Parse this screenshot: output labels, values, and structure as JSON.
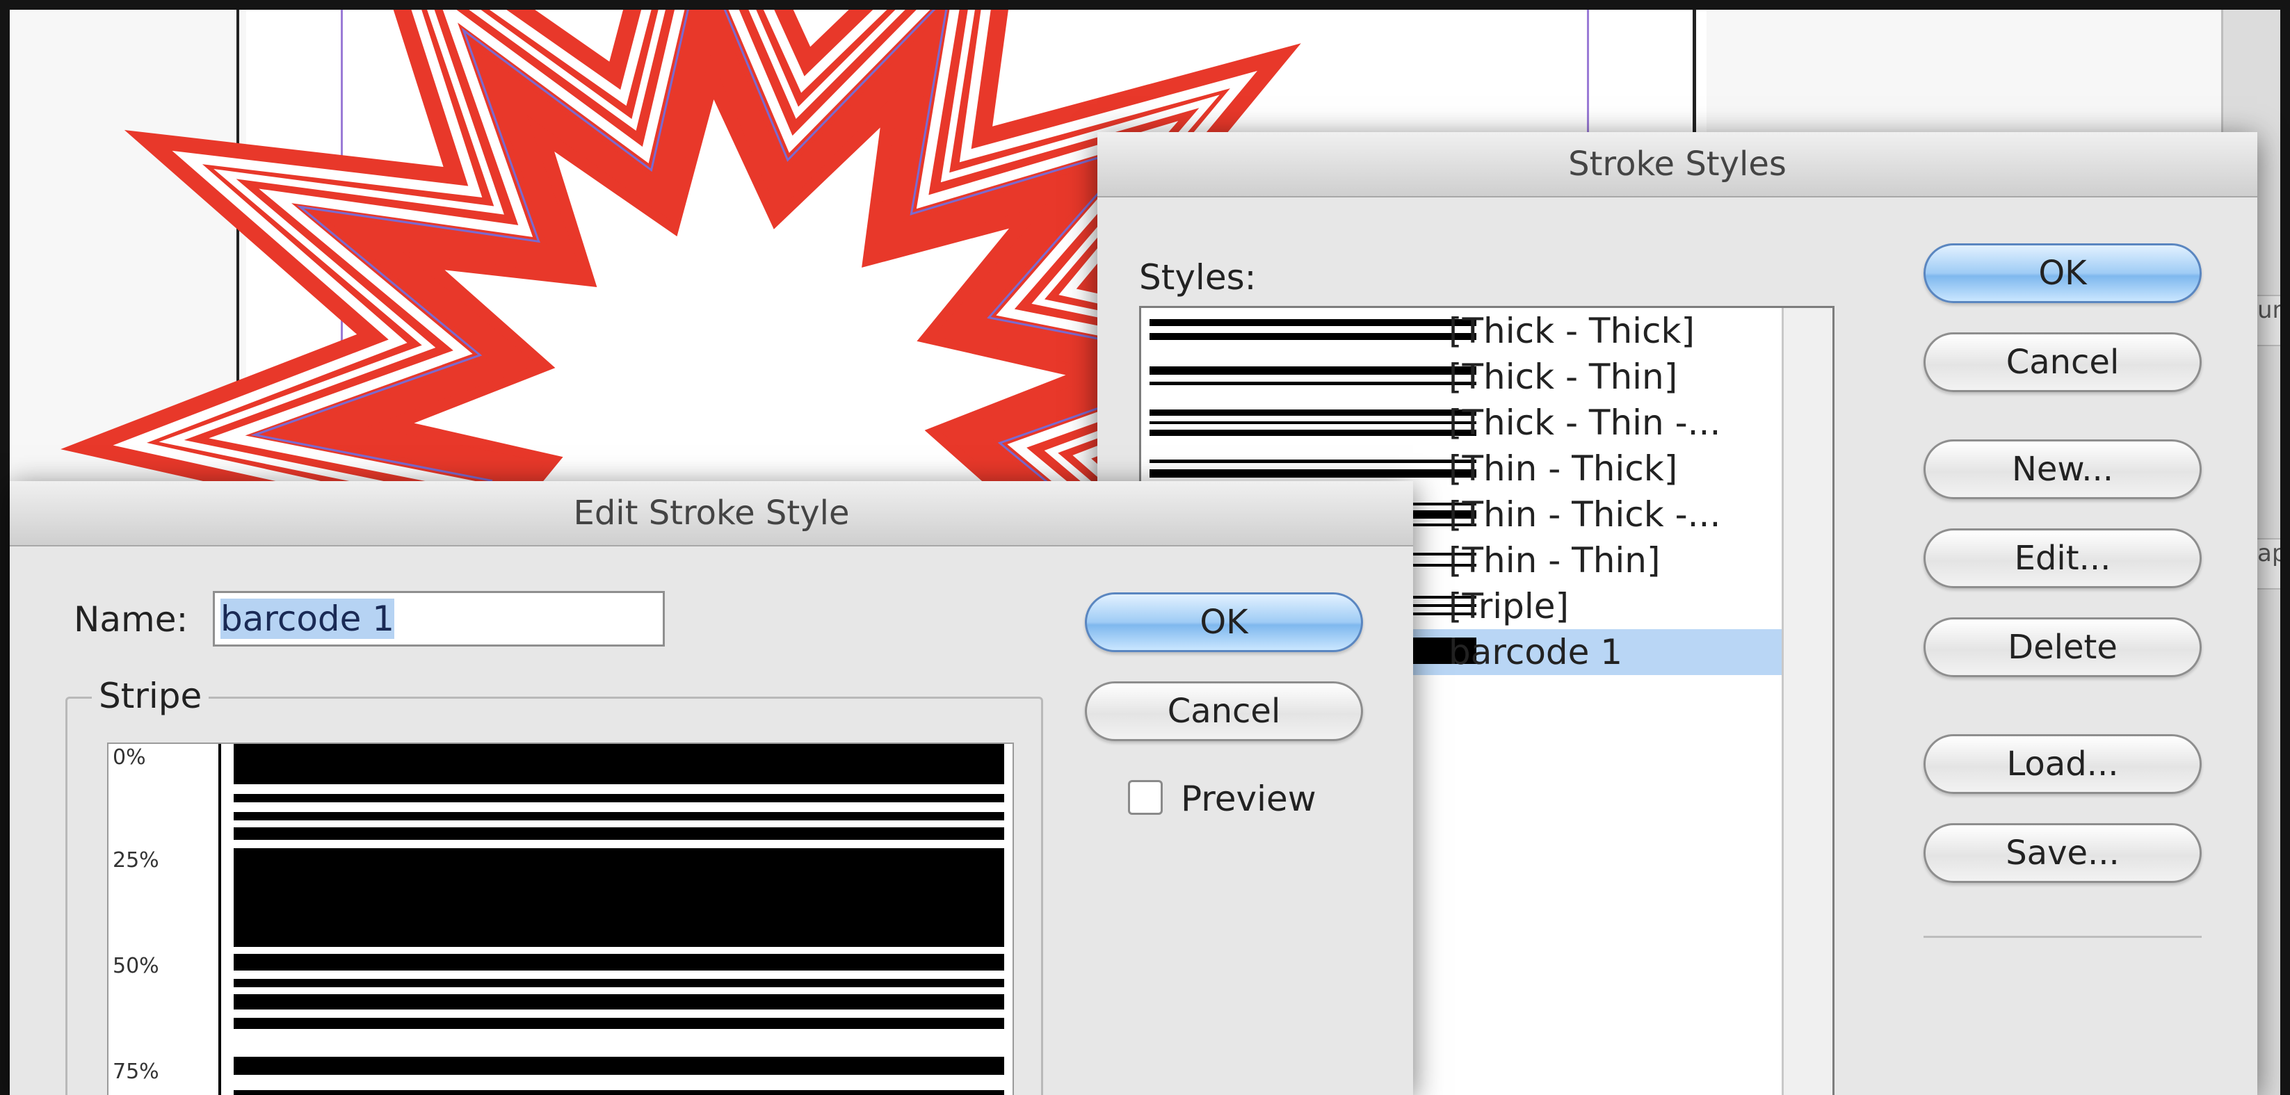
{
  "stroke_styles_dialog": {
    "title": "Stroke Styles",
    "styles_label": "Styles:",
    "styles": [
      {
        "label": "[Thick - Thick]",
        "selected": false
      },
      {
        "label": "[Thick - Thin]",
        "selected": false
      },
      {
        "label": "[Thick - Thin -...",
        "selected": false
      },
      {
        "label": "[Thin - Thick]",
        "selected": false
      },
      {
        "label": "[Thin - Thick -...",
        "selected": false
      },
      {
        "label": "[Thin - Thin]",
        "selected": false
      },
      {
        "label": "[Triple]",
        "selected": false
      },
      {
        "label": "barcode 1",
        "selected": true
      }
    ],
    "buttons": {
      "ok": "OK",
      "cancel": "Cancel",
      "new": "New...",
      "edit": "Edit...",
      "delete": "Delete",
      "load": "Load...",
      "save": "Save..."
    }
  },
  "edit_stroke_style_dialog": {
    "title": "Edit Stroke Style",
    "name_label": "Name:",
    "name_value": "barcode 1",
    "stripe_group_label": "Stripe",
    "percent_labels": [
      "0%",
      "25%",
      "50%",
      "75%"
    ],
    "ok_label": "OK",
    "cancel_label": "Cancel",
    "preview_label": "Preview",
    "preview_checked": false
  },
  "background": {
    "panel_tab_text": "un",
    "panel_tab_text_2": "ap"
  },
  "colors": {
    "star_red": "#e8382a",
    "selection_blue": "#b9d6f5",
    "default_button_blue": "#7fb8ee",
    "guide_purple": "#9b7bd6"
  }
}
